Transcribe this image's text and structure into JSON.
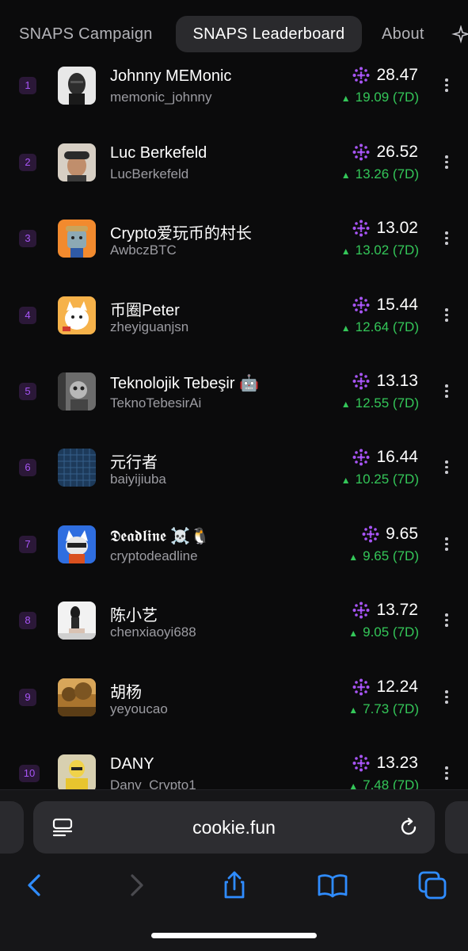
{
  "tabs": [
    {
      "label": "SNAPS  Campaign"
    },
    {
      "label": "SNAPS  Leaderboard",
      "active": true
    },
    {
      "label": "About"
    }
  ],
  "colors": {
    "accent_purple": "#a855f7",
    "positive_green": "#34c759",
    "background": "#0b0b0c"
  },
  "leaderboard": [
    {
      "rank": "1",
      "name": "Johnny MEMonic",
      "handle": "memonic_johnny",
      "score": "28.47",
      "delta": "19.09 (7D)"
    },
    {
      "rank": "2",
      "name": "Luc Berkefeld",
      "handle": "LucBerkefeld",
      "score": "26.52",
      "delta": "13.26 (7D)"
    },
    {
      "rank": "3",
      "name": "Crypto爱玩币的村长",
      "handle": "AwbczBTC",
      "score": "13.02",
      "delta": "13.02 (7D)"
    },
    {
      "rank": "4",
      "name": "币圈Peter",
      "handle": "zheyiguanjsn",
      "score": "15.44",
      "delta": "12.64 (7D)"
    },
    {
      "rank": "5",
      "name": "Teknolojik Tebeşir 🤖",
      "handle": "TeknoTebesirAi",
      "score": "13.13",
      "delta": "12.55 (7D)"
    },
    {
      "rank": "6",
      "name": "元行者",
      "handle": "baiyijiuba",
      "score": "16.44",
      "delta": "10.25 (7D)"
    },
    {
      "rank": "7",
      "name": "𝕯𝖊𝖆𝖉𝖑𝖎𝖓𝖊 ☠️🐧",
      "handle": "cryptodeadline",
      "score": "9.65",
      "delta": "9.65 (7D)"
    },
    {
      "rank": "8",
      "name": "陈小艺",
      "handle": "chenxiaoyi688",
      "score": "13.72",
      "delta": "9.05 (7D)"
    },
    {
      "rank": "9",
      "name": "胡杨",
      "handle": "yeyoucao",
      "score": "12.24",
      "delta": "7.73 (7D)"
    },
    {
      "rank": "10",
      "name": "DANY",
      "handle": "Dany_Crypto1",
      "score": "13.23",
      "delta": "7.48 (7D)"
    }
  ],
  "browser": {
    "url": "cookie.fun",
    "icons": [
      "reader-icon",
      "reload-icon",
      "back-icon",
      "forward-icon",
      "share-icon",
      "bookmarks-icon",
      "tabs-icon"
    ]
  }
}
